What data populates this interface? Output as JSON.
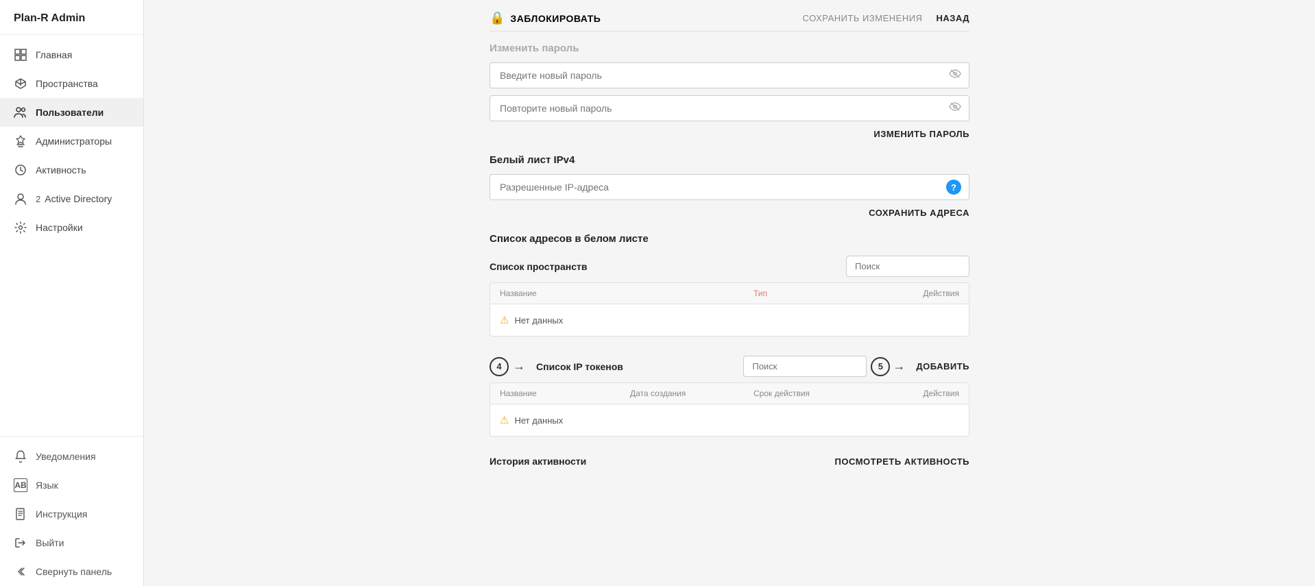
{
  "app": {
    "title": "Plan-R Admin"
  },
  "sidebar": {
    "items": [
      {
        "id": "main",
        "label": "Главная",
        "icon": "grid"
      },
      {
        "id": "spaces",
        "label": "Пространства",
        "icon": "cube"
      },
      {
        "id": "users",
        "label": "Пользователи",
        "icon": "users",
        "active": true
      },
      {
        "id": "admins",
        "label": "Администраторы",
        "icon": "admin"
      },
      {
        "id": "activity",
        "label": "Активность",
        "icon": "clock"
      },
      {
        "id": "active-directory",
        "label": "Active Directory",
        "icon": "ad",
        "badge": "2"
      },
      {
        "id": "settings",
        "label": "Настройки",
        "icon": "gear"
      }
    ],
    "bottom": [
      {
        "id": "notifications",
        "label": "Уведомления",
        "icon": "bell"
      },
      {
        "id": "language",
        "label": "Язык",
        "icon": "lang"
      },
      {
        "id": "manual",
        "label": "Инструкция",
        "icon": "book"
      },
      {
        "id": "logout",
        "label": "Выйти",
        "icon": "exit"
      },
      {
        "id": "collapse",
        "label": "Свернуть панель",
        "icon": "collapse"
      }
    ]
  },
  "topbar": {
    "block_label": "ЗАБЛОКИРОВАТЬ",
    "save_label": "СОХРАНИТЬ ИЗМЕНЕНИЯ",
    "back_label": "НАЗАД"
  },
  "password_section": {
    "title": "Изменить пароль",
    "new_password_placeholder": "Введите новый пароль",
    "confirm_password_placeholder": "Повторите новый пароль",
    "change_button": "ИЗМЕНИТЬ ПАРОЛЬ"
  },
  "ipv4_section": {
    "title": "Белый лист IPv4",
    "ip_placeholder": "Разрешенные IP-адреса",
    "save_button": "СОХРАНИТЬ АДРЕСА"
  },
  "whitelist_section": {
    "title": "Список адресов в белом листе"
  },
  "spaces_section": {
    "title": "Список пространств",
    "search_placeholder": "Поиск",
    "columns": {
      "name": "Название",
      "type": "Тип",
      "actions": "Действия"
    },
    "empty_text": "Нет данных"
  },
  "tokens_section": {
    "title": "Список IP токенов",
    "search_placeholder": "Поиск",
    "add_button": "ДОБАВИТЬ",
    "columns": {
      "name": "Название",
      "created": "Дата создания",
      "expires": "Срок действия",
      "actions": "Действия"
    },
    "empty_text": "Нет данных",
    "callout_number": "4",
    "search_callout_number": "5"
  },
  "activity_section": {
    "title": "История активности",
    "view_button": "ПОСМОТРЕТЬ АКТИВНОСТЬ"
  }
}
